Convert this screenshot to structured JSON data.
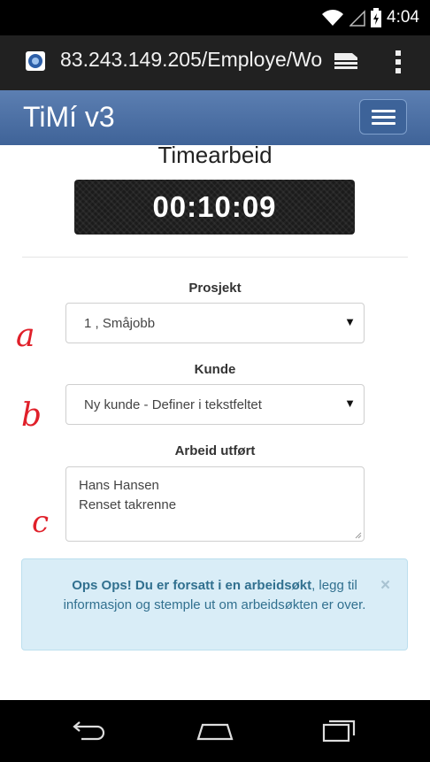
{
  "status_bar": {
    "time": "4:04"
  },
  "browser": {
    "url": "83.243.149.205/Employe/Wo"
  },
  "navbar": {
    "brand": "TiMí v3"
  },
  "page": {
    "title": "Timearbeid",
    "timer": "00:10:09"
  },
  "form": {
    "project_label": "Prosjekt",
    "project_value": "1 , Småjobb",
    "customer_label": "Kunde",
    "customer_value": "Ny kunde - Definer i tekstfeltet",
    "work_label": "Arbeid utført",
    "work_lines": [
      "Hans Hansen",
      "Renset takrenne"
    ]
  },
  "annotations": {
    "a": "a",
    "b": "b",
    "c": "c"
  },
  "alert": {
    "strong": "Ops Ops! Du er forsatt i en arbeidsøkt",
    "rest": ", legg til informasjon og stemple ut om arbeidsøkten er over.",
    "close": "×"
  },
  "colors": {
    "navbar": "#4a6fa5",
    "alert_bg": "#d9edf7",
    "alert_text": "#31708f",
    "annotation": "#e0202a"
  },
  "icons": [
    "wifi-icon",
    "signal-icon",
    "battery-icon",
    "favicon-icon",
    "tabs-icon",
    "overflow-menu-icon",
    "hamburger-icon",
    "dropdown-arrow-icon",
    "close-icon",
    "back-icon",
    "home-icon",
    "recents-icon"
  ]
}
